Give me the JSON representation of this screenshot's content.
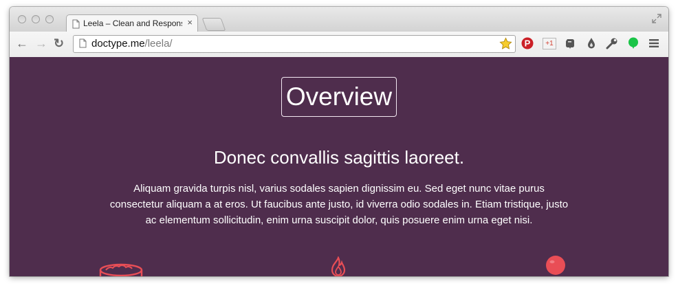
{
  "browser": {
    "tab_title": "Leela – Clean and Responsi",
    "tab_close": "×",
    "url_domain": "doctype.me",
    "url_path": "/leela/",
    "nav": {
      "back": "←",
      "forward": "→",
      "reload": "↻"
    },
    "extensions": [
      "star-icon",
      "pinterest-icon",
      "google-plus-icon",
      "evernote-icon",
      "drop-icon",
      "wrench-icon",
      "green-status-icon",
      "menu-icon"
    ],
    "extension_labels": {
      "google_plus": "+1"
    }
  },
  "page": {
    "background": "#4f2d4d",
    "accent": "#e94e56",
    "section_title": "Overview",
    "heading": "Donec convallis sagittis laoreet.",
    "paragraph": "Aliquam gravida turpis nisl, varius sodales sapien dignissim eu. Sed eget nunc vitae purus consectetur aliquam a at eros. Ut faucibus ante justo, id viverra odio sodales in. Etiam tristique, justo ac elementum sollicitudin, enim urna suscipit dolor, quis posuere enim urna eget nisi.",
    "feature_icons": [
      "bowl-icon",
      "flame-icon",
      "balloon-icon"
    ]
  }
}
